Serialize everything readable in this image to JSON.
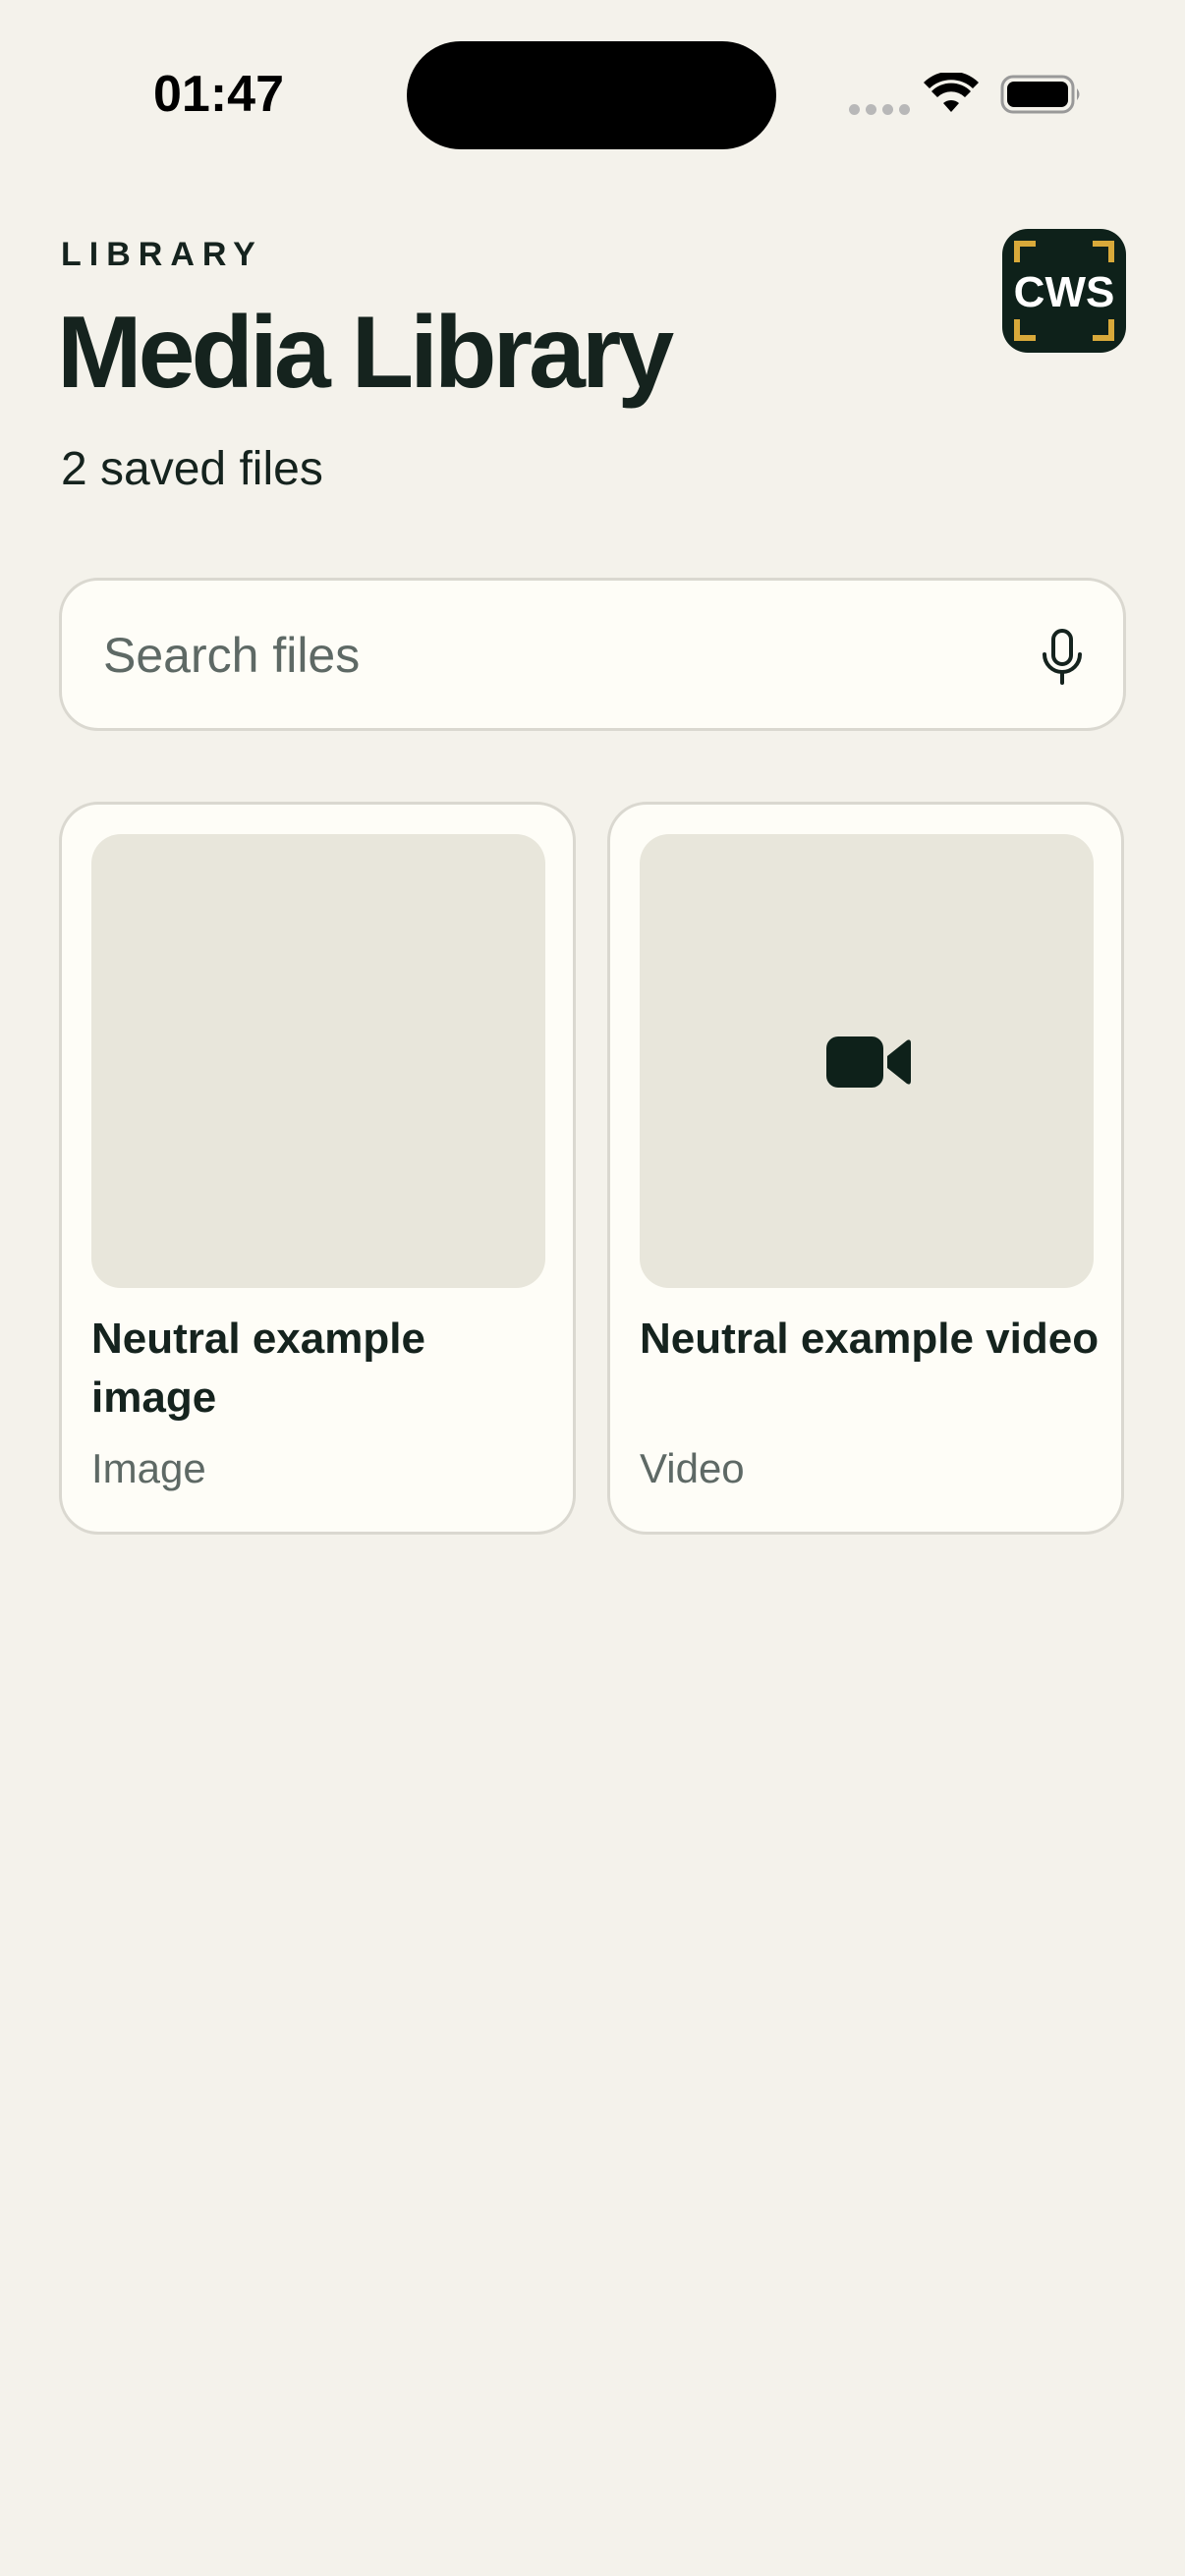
{
  "status_bar": {
    "time": "01:47"
  },
  "header": {
    "eyebrow": "LIBRARY",
    "title": "Media Library",
    "subtitle": "2 saved files",
    "logo_text": "CWS"
  },
  "search": {
    "placeholder": "Search files",
    "value": "",
    "icon": "mic-icon"
  },
  "files": [
    {
      "title": "Neutral example image",
      "type": "Image",
      "icon": null
    },
    {
      "title": "Neutral example video",
      "type": "Video",
      "icon": "video-camera-icon"
    }
  ],
  "colors": {
    "background": "#F4F2EB",
    "card": "#FEFDF7",
    "thumbnail": "#E8E6DB",
    "text_primary": "#15231E",
    "text_secondary": "#5E6965",
    "brand_dark": "#0E211A",
    "brand_accent": "#D8A93A"
  }
}
